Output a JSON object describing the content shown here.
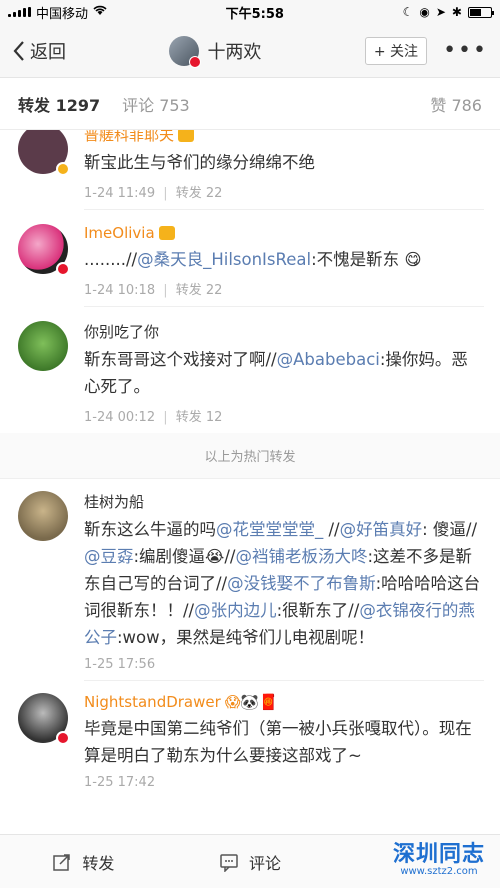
{
  "status": {
    "carrier": "中国移动",
    "time": "下午5:58"
  },
  "nav": {
    "back_label": "返回",
    "title": "十两欢",
    "follow_label": "+ 关注",
    "more_label": "•••"
  },
  "tabs": {
    "repost": "转发 1297",
    "comment": "评论 753",
    "likes": "赞 786"
  },
  "reposts": [
    {
      "name": "普艖科菲耶夫",
      "content": "靳宝此生与爷们的缘分绵绵不绝",
      "date": "1-24 11:49",
      "repost": "转发 22",
      "avatar_color": "#5b3b4a",
      "badge_color": "#f5b21b"
    },
    {
      "name": "ImeOlivia",
      "content_pre": "........//",
      "mention": "@桑天良_HilsonIsReal",
      "content_post": ":不愧是靳东 😋",
      "date": "1-24 10:18",
      "repost": "转发 22",
      "avatar_color": "#e5579a",
      "badge_color": "#e6162d"
    },
    {
      "name": "你别吃了你",
      "content_pre": "靳东哥哥这个戏接对了啊//",
      "mention": "@Ababebaci",
      "content_post": ":操你妈。恶心死了。",
      "date": "1-24 00:12",
      "repost": "转发 12",
      "avatar_color": "#5c8a3e"
    }
  ],
  "hot_divider": "以上为热门转发",
  "recent": [
    {
      "name": "桂树为船",
      "segments": [
        {
          "t": "靳东这么牛逼的吗"
        },
        {
          "t": "@花堂堂堂堂_",
          "at": true
        },
        {
          "t": " //"
        },
        {
          "t": "@好笛真好",
          "at": true
        },
        {
          "t": ": 傻逼//"
        },
        {
          "t": "@豆孬",
          "at": true
        },
        {
          "t": ":编剧傻逼😭//"
        },
        {
          "t": "@裆铺老板汤大咚",
          "at": true
        },
        {
          "t": ":这差不多是靳东自己写的台词了//"
        },
        {
          "t": "@没钱娶不了布鲁斯",
          "at": true
        },
        {
          "t": ":哈哈哈哈这台词很靳东！！//"
        },
        {
          "t": "@张内边儿",
          "at": true
        },
        {
          "t": ":很靳东了//"
        },
        {
          "t": "@衣锦夜行的燕公子",
          "at": true
        },
        {
          "t": ":wow，果然是纯爷们儿电视剧呢！"
        }
      ],
      "date": "1-25 17:56",
      "avatar_color": "#8a7a5c"
    },
    {
      "name": "NightstandDrawer",
      "name_suffix": "😱🐼🧧",
      "content": "毕竟是中国第二纯爷们（第一被小兵张嘎取代）。现在算是明白了勒东为什么要接这部戏了~",
      "date": "1-25 17:42",
      "avatar_color": "#3a3a3a",
      "badge_color": "#e6162d"
    }
  ],
  "bottom": {
    "repost_label": "转发",
    "comment_label": "评论",
    "watermark_main": "深圳同志",
    "watermark_sub": "www.sztz2.com"
  }
}
